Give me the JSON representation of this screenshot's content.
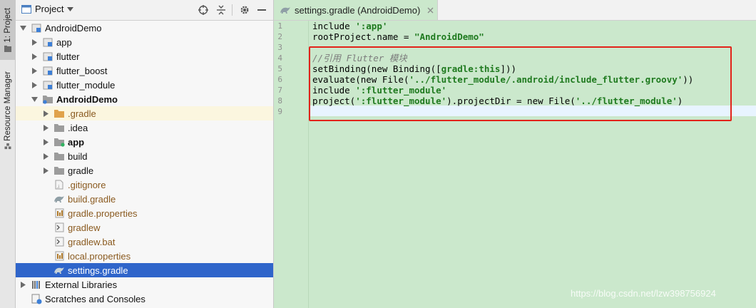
{
  "left_strip": {
    "project_tab": "1: Project",
    "resource_tab": "Resource Manager"
  },
  "project_panel": {
    "title": "Project",
    "tree": [
      {
        "label": "AndroidDemo",
        "icon": "module-icon"
      },
      {
        "label": "app",
        "icon": "module-icon"
      },
      {
        "label": "flutter",
        "icon": "module-icon"
      },
      {
        "label": "flutter_boost",
        "icon": "module-icon"
      },
      {
        "label": "flutter_module",
        "icon": "module-icon"
      },
      {
        "label": "AndroidDemo",
        "icon": "folder-icon"
      },
      {
        "label": ".gradle",
        "icon": "folder-icon"
      },
      {
        "label": ".idea",
        "icon": "folder-icon"
      },
      {
        "label": "app",
        "icon": "folder-icon"
      },
      {
        "label": "build",
        "icon": "folder-icon"
      },
      {
        "label": "gradle",
        "icon": "folder-icon"
      },
      {
        "label": ".gitignore",
        "icon": "file-icon"
      },
      {
        "label": "build.gradle",
        "icon": "gradle-icon"
      },
      {
        "label": "gradle.properties",
        "icon": "properties-icon"
      },
      {
        "label": "gradlew",
        "icon": "script-icon"
      },
      {
        "label": "gradlew.bat",
        "icon": "script-icon"
      },
      {
        "label": "local.properties",
        "icon": "properties-icon"
      },
      {
        "label": "settings.gradle",
        "icon": "gradle-icon"
      },
      {
        "label": "External Libraries",
        "icon": "library-icon"
      },
      {
        "label": "Scratches and Consoles",
        "icon": "scratch-icon"
      }
    ]
  },
  "editor": {
    "tab_label": "settings.gradle (AndroidDemo)",
    "line_numbers": [
      "1",
      "2",
      "3",
      "4",
      "5",
      "6",
      "7",
      "8",
      "9"
    ],
    "code": {
      "l1_kw": "include ",
      "l1_str": "':app'",
      "l2_a": "rootProject.name = ",
      "l2_str": "\"AndroidDemo\"",
      "l4_cmt": "//引用 Flutter 模块",
      "l5_a": "setBinding(",
      "l5_new": "new",
      "l5_b": " Binding([",
      "l5_c": "gradle:this",
      "l5_d": "]))",
      "l6_a": "evaluate(",
      "l6_new": "new",
      "l6_b": " File(",
      "l6_str": "'../flutter_module/.android/include_flutter.groovy'",
      "l6_c": "))",
      "l7_kw": "include ",
      "l7_str": "':flutter_module'",
      "l8_a": "project(",
      "l8_str": "':flutter_module'",
      "l8_b": ").projectDir = ",
      "l8_new": "new",
      "l8_c": " File(",
      "l8_str2": "'../flutter_module'",
      "l8_d": ")"
    }
  },
  "watermark": "https://blog.csdn.net/lzw398756924",
  "colors": {
    "editor_bg": "#cbe8cc",
    "selection": "#2f65ca",
    "highlight_box": "#e2231a",
    "string": "#1f7a1f"
  }
}
